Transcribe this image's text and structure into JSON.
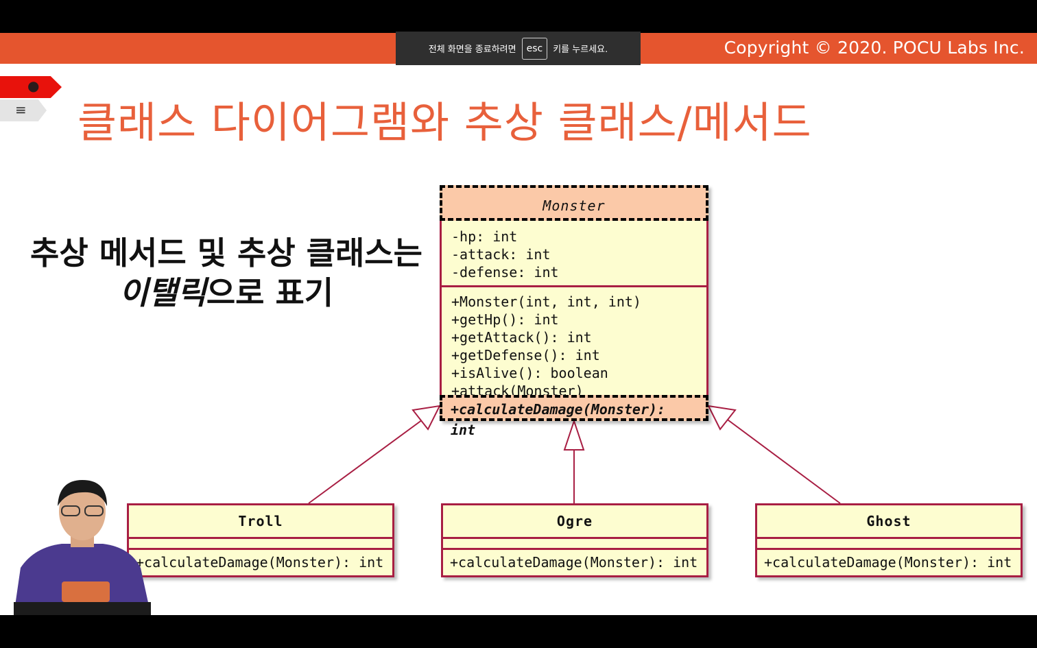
{
  "toast": {
    "prefix": "전체 화면을 종료하려면",
    "key": "esc",
    "suffix": "키를 누르세요."
  },
  "banner": {
    "copyright": "Copyright © 2020. POCU Labs Inc."
  },
  "slide": {
    "title": "클래스 다이어그램와 추상 클래스/메서드",
    "note_line1": "추상 메서드 및 추상 클래스는",
    "note_italic": "이탤릭",
    "note_line2_rest": "으로 표기"
  },
  "diagram": {
    "monster": {
      "name": "Monster",
      "fields": [
        "-hp: int",
        "-attack: int",
        "-defense: int"
      ],
      "methods": [
        "+Monster(int, int, int)",
        "+getHp(): int",
        "+getAttack(): int",
        "+getDefense(): int",
        "+isAlive(): boolean",
        "+attack(Monster)"
      ],
      "abstract_method": "+calculateDamage(Monster): int"
    },
    "subclasses": [
      {
        "name": "Troll",
        "method": "+calculateDamage(Monster): int"
      },
      {
        "name": "Ogre",
        "method": "+calculateDamage(Monster): int"
      },
      {
        "name": "Ghost",
        "method": "+calculateDamage(Monster): int"
      }
    ],
    "line_color": "#a81e43",
    "box_fill": "#fdfdd0",
    "abstract_fill": "#fbc9a8"
  },
  "colors": {
    "banner": "#e5552e",
    "title": "#e8603b"
  },
  "icons": {
    "tag_red": "brain-icon",
    "tag_grey": "books-icon"
  }
}
